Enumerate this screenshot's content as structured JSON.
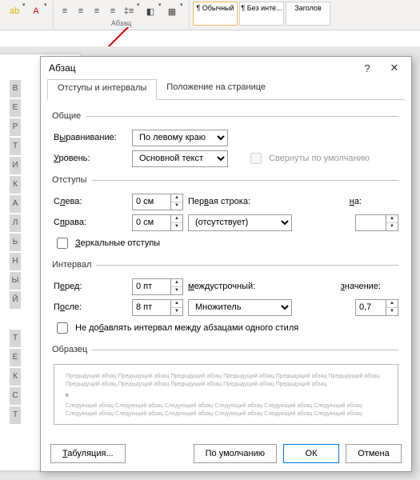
{
  "ribbon": {
    "group_label": "Абзац",
    "styles": [
      "¶ Обычный",
      "¶ Без инте...",
      "Заголов"
    ]
  },
  "vertical_text": [
    "В",
    "Е",
    "Р",
    "Т",
    "И",
    "К",
    "А",
    "Л",
    "Ь",
    "Н",
    "Ы",
    "Й",
    "",
    "Т",
    "Е",
    "К",
    "С",
    "Т"
  ],
  "dialog": {
    "title": "Абзац",
    "tabs": {
      "t1": "Отступы и интервалы",
      "t2": "Положение на странице"
    },
    "general": {
      "legend": "Общие",
      "align_label_pre": "В",
      "align_label_u": "ы",
      "align_label_post": "равнивание:",
      "align_value": "По левому краю",
      "level_label_u": "У",
      "level_label_post": "ровень:",
      "level_value": "Основной текст",
      "collapse_label": "Свернуты по умолчанию"
    },
    "indent": {
      "legend": "Отступы",
      "left_label_pre": "С",
      "left_label_u": "л",
      "left_label_post": "ева:",
      "left_value": "0 см",
      "right_label_pre": "С",
      "right_label_u": "п",
      "right_label_post": "рава:",
      "right_value": "0 см",
      "first_label_pre": "Пер",
      "first_label_u": "в",
      "first_label_post": "ая строка:",
      "first_value": "(отсутствует)",
      "na_label_u": "н",
      "na_label_post": "а:",
      "na_value": "",
      "mirror_label_u": "З",
      "mirror_label_post": "еркальные отступы"
    },
    "interval": {
      "legend": "Интервал",
      "before_label_pre": "П",
      "before_label_u": "е",
      "before_label_post": "ред:",
      "before_value": "0 пт",
      "after_label_pre": "П",
      "after_label_u": "о",
      "after_label_post": "сле:",
      "after_value": "8 пт",
      "line_label_u": "м",
      "line_label_post": "еждустрочный:",
      "line_value": "Множитель",
      "val_label_u": "з",
      "val_label_post": "начение:",
      "val_value": "0,7",
      "nospace_label_pre": "Не до",
      "nospace_label_u": "б",
      "nospace_label_post": "авлять интервал между абзацами одного стиля"
    },
    "preview": {
      "legend": "Образец",
      "pre": "Предыдущий абзац Предыдущий абзац Предыдущий абзац Предыдущий абзац Предыдущий абзац Предыдущий абзац Предыдущий абзац Предыдущий абзац Предыдущий абзац Предыдущий абзац Предыдущий абзац",
      "mid": "в",
      "post": "Следующий абзац Следующий абзац Следующий абзац Следующий абзац Следующий абзац Следующий абзац Следующий абзац Следующий абзац Следующий абзац Следующий абзац Следующий абзац Следующий абзац"
    },
    "buttons": {
      "tabs_u": "Т",
      "tabs_post": "абуляция...",
      "default": "По умолчанию",
      "ok": "ОК",
      "cancel": "Отмена"
    }
  }
}
